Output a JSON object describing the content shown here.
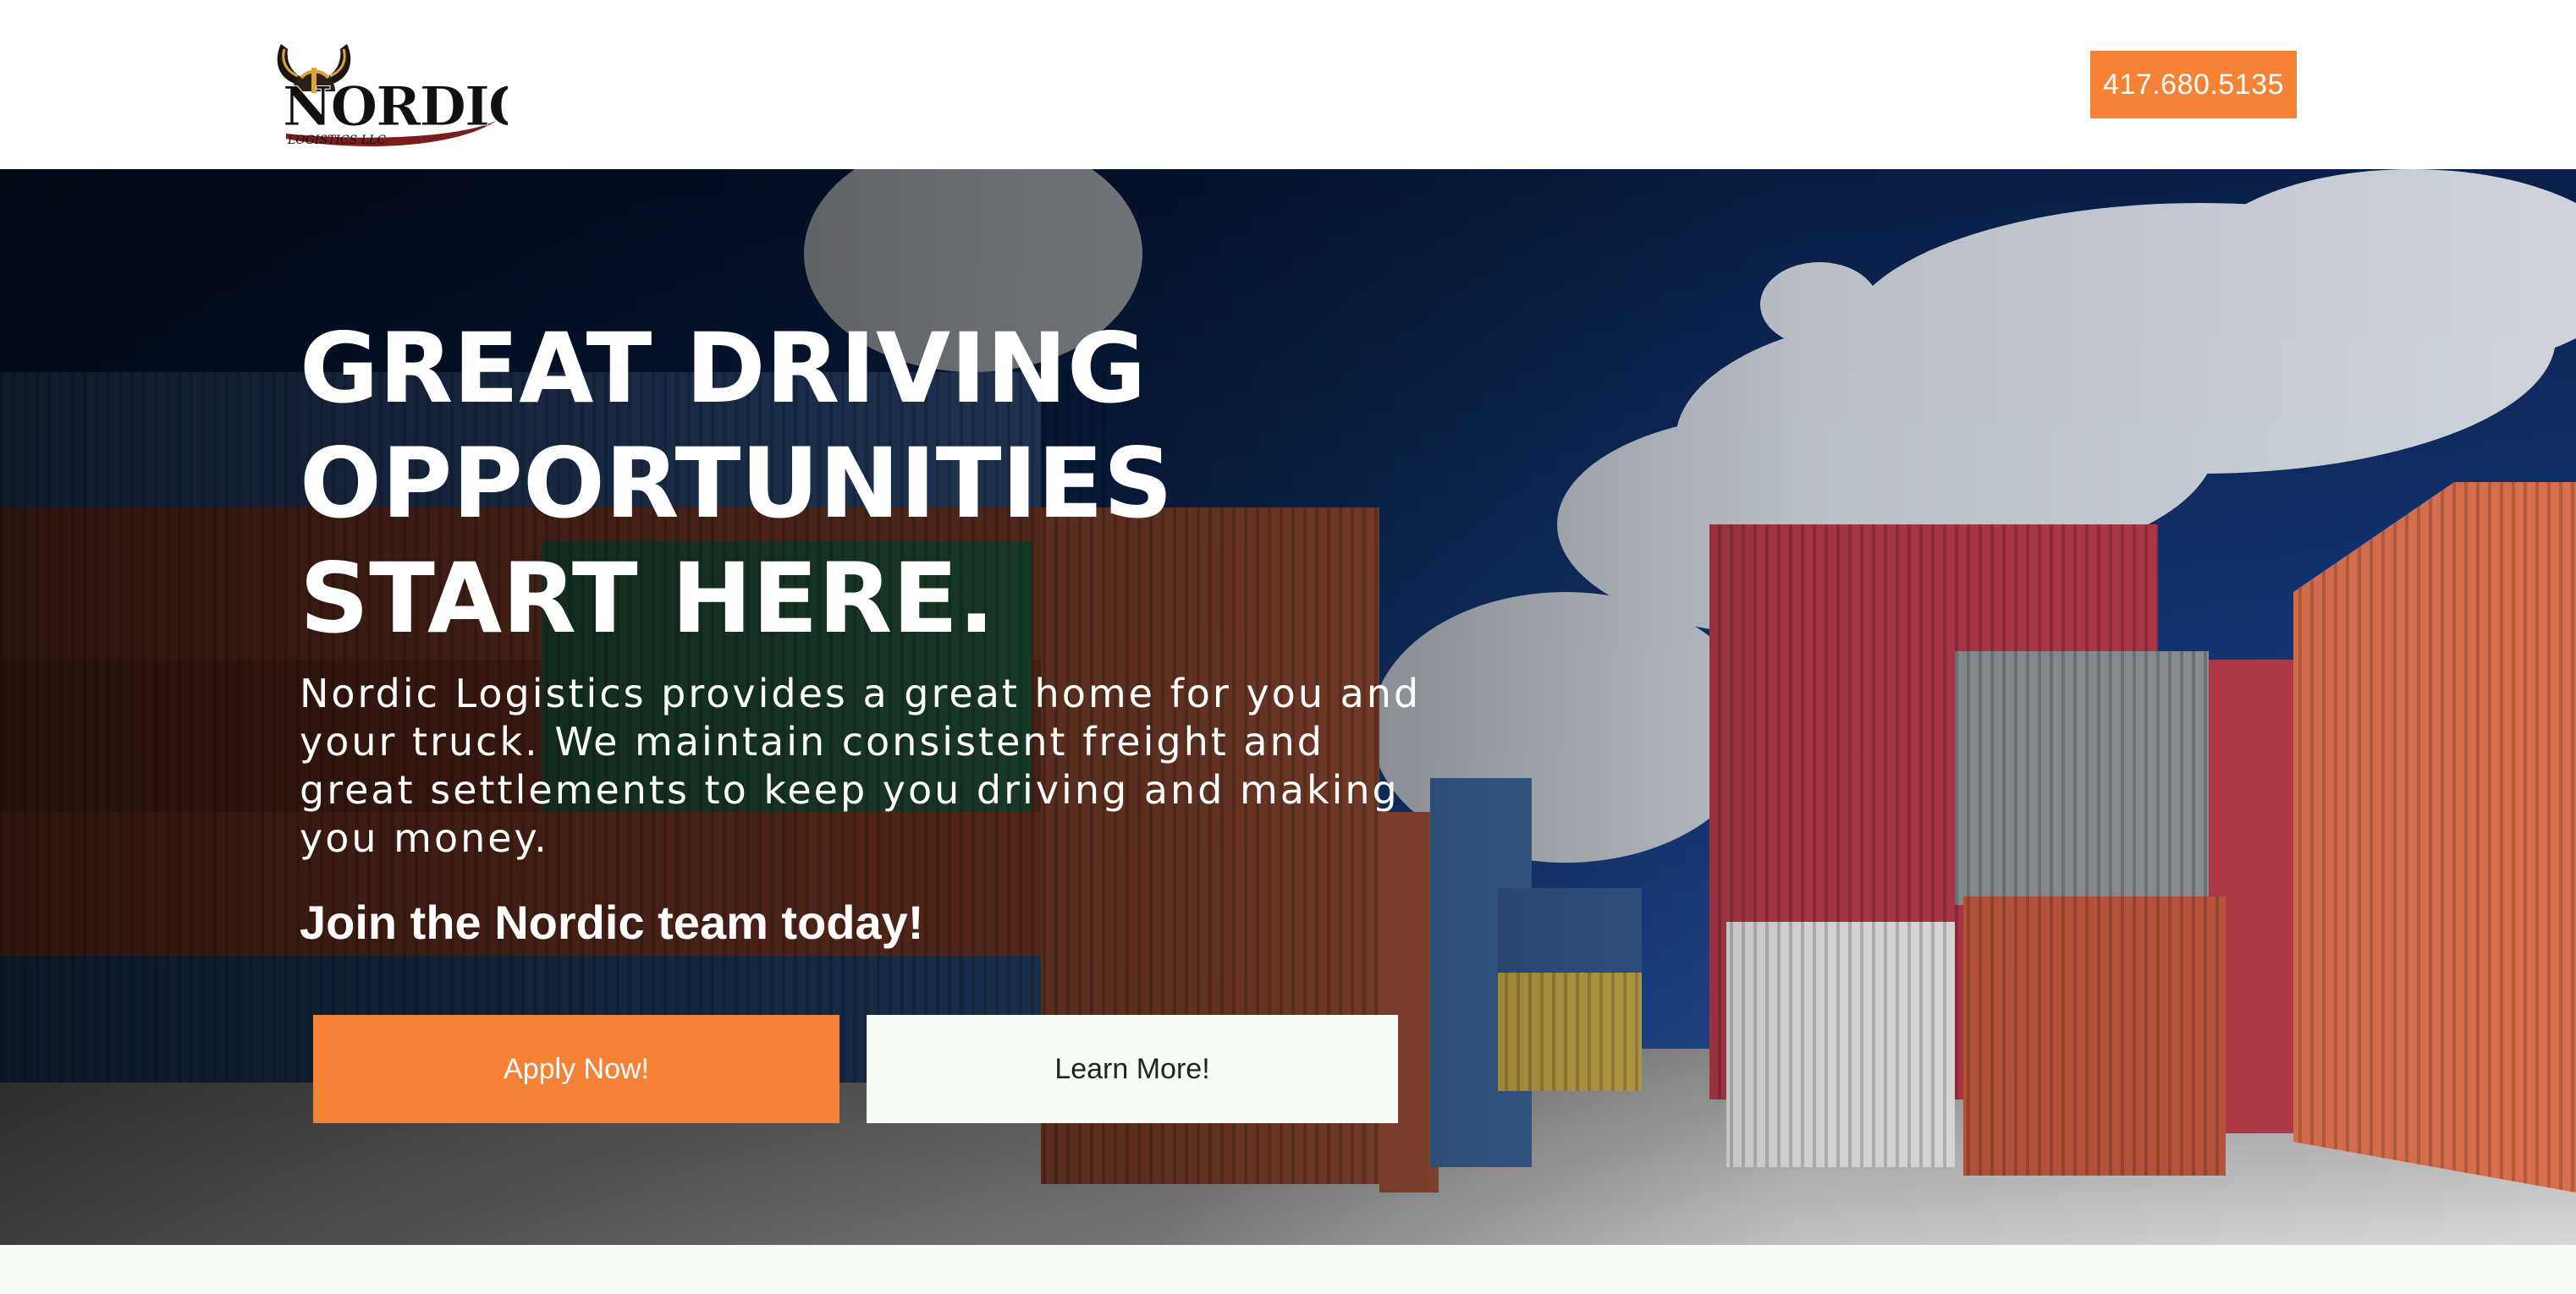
{
  "header": {
    "logo": {
      "name": "Nordic Logistics logo",
      "wordmark": "NORDIC",
      "subtext": "LOGISTICS LLC"
    },
    "phone": "417.680.5135"
  },
  "hero": {
    "title_lines": [
      "GREAT DRIVING",
      "OPPORTUNITIES",
      "START HERE."
    ],
    "description": "Nordic Logistics provides a great home for you and your truck. We maintain consistent freight and great settlements to keep you driving and making you money.",
    "join_text": "Join the Nordic team today!",
    "apply_label": "Apply Now!",
    "learn_label": "Learn More!",
    "background": "shipping containers at a port under cloudy blue sky"
  },
  "colors": {
    "accent": "#f68235",
    "light": "#f7fcf5",
    "sky": "#0e2a5c"
  }
}
